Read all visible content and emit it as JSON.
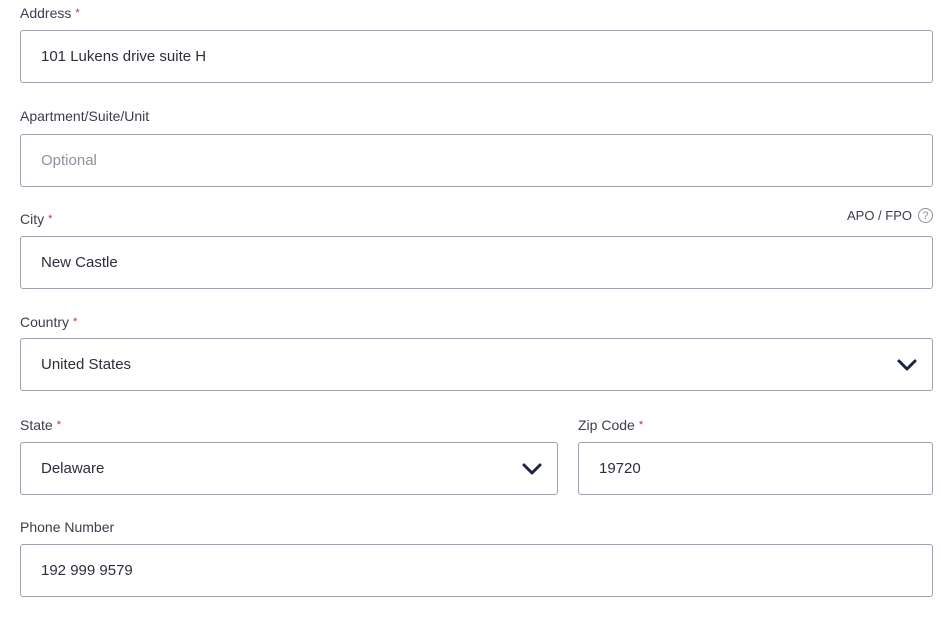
{
  "fields": {
    "address": {
      "label": "Address",
      "required_mark": "*",
      "value": "101 Lukens drive suite H"
    },
    "apartment": {
      "label": "Apartment/Suite/Unit",
      "placeholder": "Optional",
      "value": ""
    },
    "city": {
      "label": "City",
      "required_mark": "*",
      "value": "New Castle",
      "aux_label": "APO / FPO",
      "help_icon": "?"
    },
    "country": {
      "label": "Country",
      "required_mark": "*",
      "selected": "United States"
    },
    "state": {
      "label": "State",
      "required_mark": "*",
      "selected": "Delaware"
    },
    "zip": {
      "label": "Zip Code",
      "required_mark": "*",
      "value": "19720"
    },
    "phone": {
      "label": "Phone Number",
      "value": "192 999 9579"
    }
  },
  "icons": {
    "dropdown": "chevron-down-icon",
    "help": "question-circle-icon"
  },
  "colors": {
    "required": "#d0283a",
    "border": "#9ea3ad",
    "chevron": "#1c2440",
    "placeholder": "#8d919a"
  }
}
